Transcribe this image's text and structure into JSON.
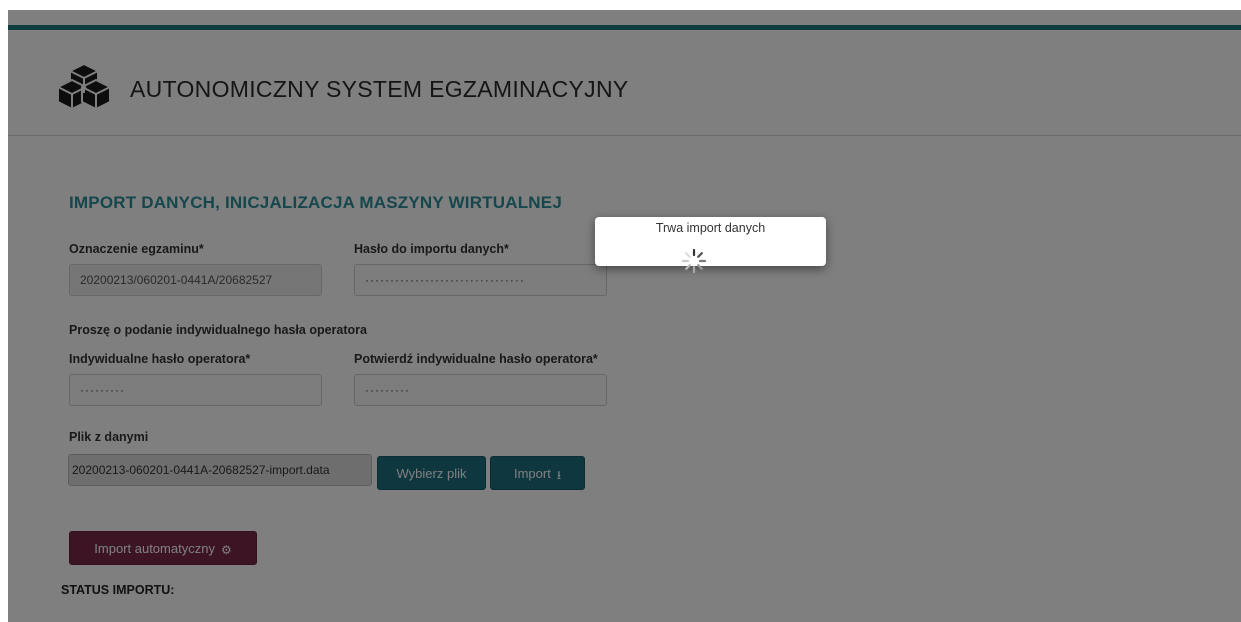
{
  "header": {
    "title": "AUTONOMICZNY SYSTEM EGZAMINACYJNY",
    "logo_icon": "cubes-icon",
    "accent_color": "#1c7a80"
  },
  "form": {
    "section_title": "IMPORT DANYCH, INICJALIZACJA MASZYNY WIRTUALNEJ",
    "exam_id": {
      "label": "Oznaczenie egzaminu*",
      "value": "20200213/060201-0441A/20682527"
    },
    "import_password": {
      "label": "Hasło do importu danych*",
      "value": "································"
    },
    "operator_prompt": "Proszę o podanie indywidualnego hasła operatora",
    "operator_password": {
      "label": "Indywidualne hasło operatora*",
      "value": "·········"
    },
    "operator_password_confirm": {
      "label": "Potwierdź indywidualne hasło operatora*",
      "value": "·········"
    },
    "data_file": {
      "label": "Plik z danymi",
      "value": "20200213-060201-0441A-20682527-import.data"
    },
    "choose_file_button": "Wybierz plik",
    "import_button": "Import",
    "import_icon": "download-icon",
    "auto_import_button": "Import automatyczny",
    "auto_import_icon": "cogs-icon",
    "status_label": "STATUS IMPORTU:"
  },
  "modal": {
    "message": "Trwa import danych",
    "spinner_icon": "loading-spinner-icon"
  }
}
